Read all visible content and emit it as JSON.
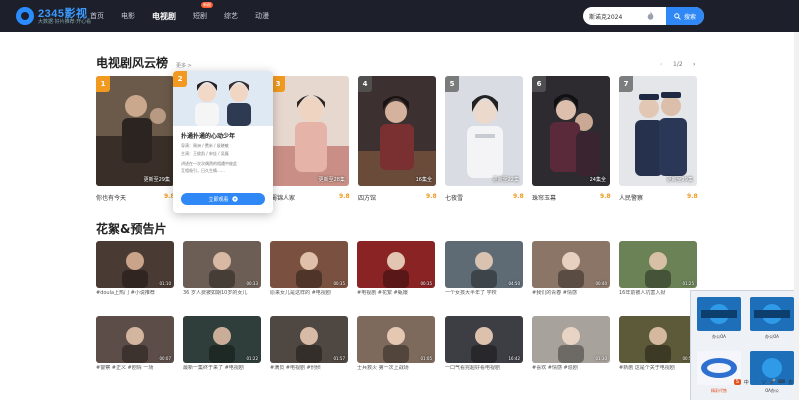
{
  "brand": {
    "name": "2345影视",
    "slogan": "大数据·好片推荐·开心看",
    "accent": "#2f88f5"
  },
  "nav": [
    {
      "label": "首页",
      "active": false
    },
    {
      "label": "电影",
      "active": false
    },
    {
      "label": "电视剧",
      "active": true
    },
    {
      "label": "短剧",
      "active": false,
      "badge": "新剧"
    },
    {
      "label": "综艺",
      "active": false
    },
    {
      "label": "动漫",
      "active": false
    }
  ],
  "search": {
    "value": "斯诺克2024",
    "button_label": "搜索"
  },
  "ranking": {
    "title": "电视剧风云榜",
    "more": "更多 >",
    "pager": {
      "prev": "‹",
      "current": "1/2",
      "next": "›"
    },
    "items": [
      {
        "rank": "1",
        "title": "你也有今天",
        "status": "更新至29集",
        "score": "9.8"
      },
      {
        "rank": "2",
        "title": "扑通扑通的心动少年",
        "status": "",
        "score": ""
      },
      {
        "rank": "3",
        "title": "蜀锦人家",
        "status": "更新至28集",
        "score": "9.8"
      },
      {
        "rank": "4",
        "title": "四方馆",
        "status": "16集全",
        "score": "9.8"
      },
      {
        "rank": "5",
        "title": "七夜雪",
        "status": "更新至22集",
        "score": "9.8"
      },
      {
        "rank": "6",
        "title": "珠帘玉幕",
        "status": "24集全",
        "score": "9.8"
      },
      {
        "rank": "7",
        "title": "人民警察",
        "status": "更新至29集",
        "score": "9.8"
      }
    ]
  },
  "popover": {
    "title": "扑通扑通的心动少年",
    "line1": "导演：周洲 / 费米 / 侯晓敏",
    "line2": "主演：王俊凯 / 宋佳 / 吴磊",
    "line3": "讲述在一次次偶然的相遇中彼此",
    "line4": "互相吸引，日久生情……",
    "button": "立即观看"
  },
  "trailers": {
    "title": "花絮&预告片",
    "row1": [
      {
        "caption": "#doula上热门 #小说推荐",
        "duration": "01:10"
      },
      {
        "caption": "36 岁人费被如期10岁的女儿",
        "duration": "00:33"
      },
      {
        "caption": "原来女儿是这样的 #电视剧",
        "duration": "00:35"
      },
      {
        "caption": "#电视剧 #花絮 #甄嬛",
        "duration": "00:35"
      },
      {
        "caption": "一个女孩大半年了 学校",
        "duration": "04:50"
      },
      {
        "caption": "#我们的青春 #情感",
        "duration": "00:40"
      },
      {
        "caption": "16年前被人坑害入狱",
        "duration": "01:25"
      }
    ],
    "row2": [
      {
        "caption": "#警察 #正义 #剧情 一场",
        "duration": "00:07"
      },
      {
        "caption": "最新一集终于来了 #电视剧",
        "duration": "01:22"
      },
      {
        "caption": "#满员 #电视剧 #刑侦",
        "duration": "01:57"
      },
      {
        "caption": "士兵救火 第一次上战场",
        "duration": "01:05"
      },
      {
        "caption": "一口气看完超好看电视剧",
        "duration": "16:42"
      },
      {
        "caption": "#喜欢 #情感 #追剧",
        "duration": "01:30"
      },
      {
        "caption": "#新剧 这是个关于电视剧",
        "duration": "00:52"
      }
    ]
  },
  "widget": {
    "cells": [
      "办公OA",
      "办公OA",
      "精彩代售",
      "OA办公"
    ],
    "ime": [
      "中",
      "·",
      "ソ",
      "🎤",
      "⌨",
      "衣",
      "⋮"
    ]
  },
  "colors": {
    "nav_bg": "#1d1f2b",
    "score": "#f29a1f"
  }
}
